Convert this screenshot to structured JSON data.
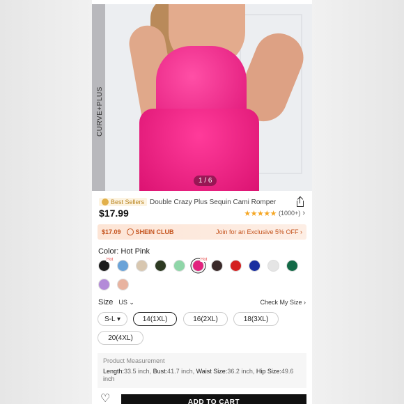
{
  "hero": {
    "brand_label": "CURVE+PLUS",
    "pager": "1 / 6"
  },
  "product": {
    "badge": "Best Sellers",
    "title": "Double Crazy Plus Sequin Cami Romper",
    "price": "$17.99",
    "rating_stars": "★★★★★",
    "rating_count": "(1000+)"
  },
  "club": {
    "price": "$17.09",
    "name": "SHEIN CLUB",
    "join": "Join for an Exclusive 5% OFF"
  },
  "color": {
    "label": "Color: Hot Pink",
    "hot_tag": "Hot",
    "swatches": [
      "#1b1b1b",
      "#6aa3d8",
      "#d8c7b0",
      "#2d3a22",
      "#8fd6a8",
      "#e2237e",
      "#3a2a2a",
      "#d42020",
      "#1a2fa0",
      "#e5e5e5",
      "#136a47",
      "#b38ad8",
      "#e8b3a0"
    ]
  },
  "size": {
    "label": "Size",
    "unit": "US ⌄",
    "check": "Check My Size",
    "options": [
      "S-L ▾",
      "14(1XL)",
      "16(2XL)",
      "18(3XL)",
      "20(4XL)"
    ]
  },
  "measurement": {
    "title": "Product Measurement",
    "length_key": "Length:",
    "length_val": "33.5 inch,",
    "bust_key": "Bust:",
    "bust_val": "41.7 inch,",
    "waist_key": "Waist Size:",
    "waist_val": "36.2 inch,",
    "hip_key": "Hip Size:",
    "hip_val": "49.6 inch"
  },
  "footer": {
    "cart": "ADD TO CART"
  }
}
